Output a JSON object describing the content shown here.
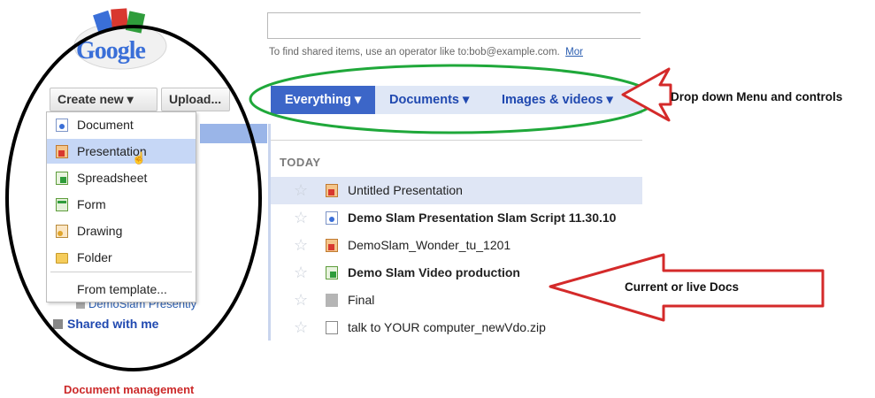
{
  "logo": {
    "text": "Google"
  },
  "search": {
    "value": "",
    "hint": "To find shared items, use an operator like to:bob@example.com.",
    "more_link": "Mor"
  },
  "toolbar": {
    "create_new_label": "Create new ▾",
    "upload_label": "Upload..."
  },
  "filter_tabs": [
    {
      "label": "Everything ▾",
      "selected": true
    },
    {
      "label": "Documents ▾",
      "selected": false
    },
    {
      "label": "Images & videos ▾",
      "selected": false
    }
  ],
  "create_menu": {
    "items": [
      {
        "label": "Document",
        "icon": "document-icon"
      },
      {
        "label": "Presentation",
        "icon": "presentation-icon",
        "hovered": true
      },
      {
        "label": "Spreadsheet",
        "icon": "spreadsheet-icon"
      },
      {
        "label": "Form",
        "icon": "form-icon"
      },
      {
        "label": "Drawing",
        "icon": "drawing-icon"
      },
      {
        "label": "Folder",
        "icon": "folder-icon"
      }
    ],
    "template_label": "From template..."
  },
  "left_nav": {
    "partial_item": "DemoSlam Presently",
    "shared_with_me": "Shared with me"
  },
  "doc_list": {
    "section_label": "TODAY",
    "rows": [
      {
        "title": "Untitled Presentation",
        "icon": "presentation-icon",
        "bold": false,
        "selected": true
      },
      {
        "title": "Demo Slam Presentation Slam Script 11.30.10",
        "icon": "document-icon",
        "bold": true,
        "selected": false
      },
      {
        "title": "DemoSlam_Wonder_tu_1201",
        "icon": "presentation-icon",
        "bold": false,
        "selected": false
      },
      {
        "title": "Demo Slam Video production",
        "icon": "spreadsheet-icon",
        "bold": true,
        "selected": false
      },
      {
        "title": "Final",
        "icon": "grey-square-icon",
        "bold": false,
        "selected": false
      },
      {
        "title": "talk to YOUR computer_newVdo.zip",
        "icon": "file-icon",
        "bold": false,
        "selected": false
      }
    ]
  },
  "annotations": {
    "top": "Drop down Menu and controls",
    "middle": "Current or live Docs",
    "bottom": "Document management",
    "colors": {
      "green": "#1fa83a",
      "red": "#d42a2a",
      "black": "#000000"
    }
  }
}
